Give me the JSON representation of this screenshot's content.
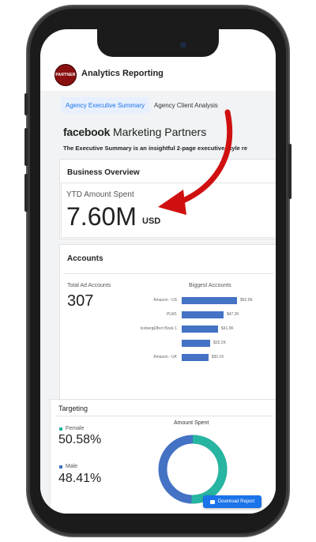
{
  "header": {
    "title": "Analytics Reporting",
    "logo_text": "PARTNER"
  },
  "tabs": [
    {
      "label": "Agency Executive Summary",
      "active": true
    },
    {
      "label": "Agency Client Analysis",
      "active": false
    }
  ],
  "brand": {
    "facebook": "facebook",
    "partners": "Marketing Partners"
  },
  "executive_text": "The Executive Summary is an insightful 2-page executive-style re",
  "business_overview": {
    "title": "Business Overview",
    "ytd_label": "YTD Amount Spent",
    "ytd_value": "7.60M",
    "ytd_unit": "USD"
  },
  "accounts": {
    "title": "Accounts",
    "total_label": "Total Ad Accounts",
    "total_value": "307",
    "biggest_label": "Biggest Accounts",
    "bars": [
      {
        "name": "Amazon - US",
        "value_label": "$62.5K",
        "value": 62.5
      },
      {
        "name": "PLM1",
        "value_label": "$47.2K",
        "value": 47.2
      },
      {
        "name": "IcebergEffect Book 1",
        "value_label": "$41.0K",
        "value": 41.0
      },
      {
        "name": "",
        "value_label": "$32.2K",
        "value": 32.2
      },
      {
        "name": "Amazon - UK",
        "value_label": "$30.1K",
        "value": 30.1
      }
    ]
  },
  "targeting": {
    "title": "Targeting",
    "female_label": "Female",
    "female_value": "50.58%",
    "male_label": "Male",
    "male_value": "48.41%",
    "donut_title": "Amount Spent",
    "female_share": 0.5058,
    "colors": {
      "female": "#26b5a0",
      "male": "#4472c4"
    }
  },
  "download_button": "Download Report"
}
